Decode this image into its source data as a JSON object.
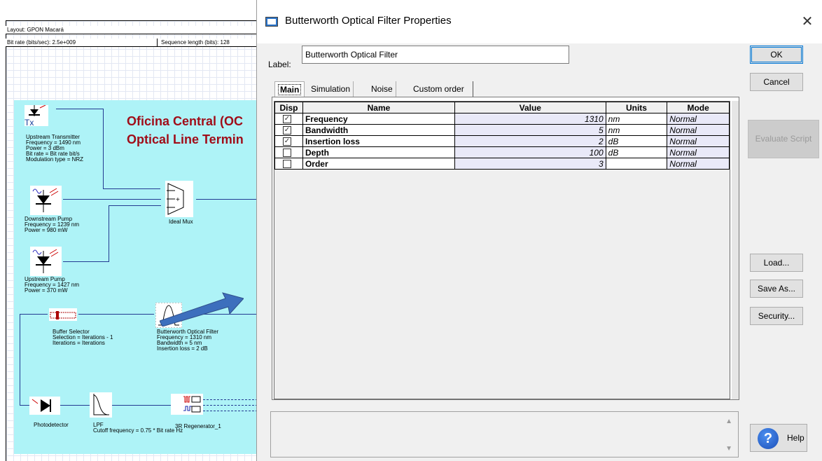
{
  "layout": {
    "header_layout": "Layout: GPON Macará",
    "header_bitrate": "Bit rate (bits/sec):  2.5e+009",
    "header_seqlen": "Sequence length (bits):  128",
    "title_line1": "Oficina Central (OC",
    "title_line2": "Optical Line Termin",
    "tx_label": "Tx",
    "components": {
      "upstream_tx": [
        "Upstream Transmitter",
        "Frequency = 1490  nm",
        "Power = 3  dBm",
        "Bit rate = Bit rate  bit/s",
        "Modulation type = NRZ"
      ],
      "downstream_pump": [
        "Downstream Pump",
        "Frequency = 1239  nm",
        "Power = 980  mW"
      ],
      "upstream_pump": [
        "Upstream Pump",
        "Frequency = 1427  nm",
        "Power = 370  mW"
      ],
      "ideal_mux": [
        "Ideal Mux"
      ],
      "buffer_selector": [
        "Buffer Selector",
        "Selection = Iterations - 1",
        "Iterations = Iterations"
      ],
      "butterworth": [
        "Butterworth Optical Filter",
        "Frequency = 1310  nm",
        "Bandwidth = 5  nm",
        "Insertion loss = 2  dB"
      ],
      "photodetector": [
        "Photodetector"
      ],
      "lpf": [
        "LPF",
        "Cutoff frequency = 0.75 * Bit rate  Hz"
      ],
      "regenerator": [
        "3R Regenerator_1"
      ]
    }
  },
  "dialog": {
    "title": "Butterworth Optical Filter Properties",
    "close_glyph": "✕",
    "label_caption": "Label:",
    "label_value": "Butterworth Optical Filter",
    "buttons": {
      "ok": "OK",
      "cancel": "Cancel",
      "evaluate": "Evaluate Script",
      "load": "Load...",
      "save_as": "Save As...",
      "security": "Security...",
      "help": "Help"
    },
    "tabs": [
      "Main",
      "Simulation",
      "Noise",
      "Custom order"
    ],
    "table": {
      "headers": [
        "Disp",
        "Name",
        "Value",
        "Units",
        "Mode"
      ],
      "rows": [
        {
          "disp": true,
          "name": "Frequency",
          "value": "1310",
          "units": "nm",
          "mode": "Normal"
        },
        {
          "disp": true,
          "name": "Bandwidth",
          "value": "5",
          "units": "nm",
          "mode": "Normal"
        },
        {
          "disp": true,
          "name": "Insertion loss",
          "value": "2",
          "units": "dB",
          "mode": "Normal"
        },
        {
          "disp": false,
          "name": "Depth",
          "value": "100",
          "units": "dB",
          "mode": "Normal"
        },
        {
          "disp": false,
          "name": "Order",
          "value": "3",
          "units": "",
          "mode": "Normal"
        }
      ]
    },
    "icons": [
      "window-icon",
      "close-icon",
      "help-icon",
      "scroll-up-icon",
      "scroll-down-icon"
    ]
  }
}
